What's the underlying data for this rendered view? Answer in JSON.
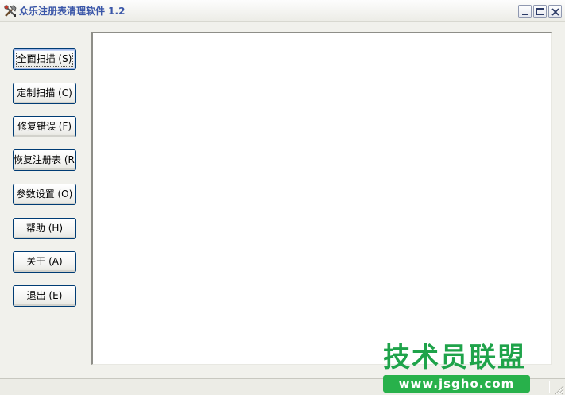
{
  "window": {
    "title": "众乐注册表清理软件 1.2",
    "icon": "tools-icon"
  },
  "window_controls": {
    "minimize_icon": "minimize-icon",
    "maximize_icon": "maximize-icon",
    "close_icon": "close-icon"
  },
  "sidebar": {
    "buttons": [
      {
        "label": "全面扫描 (S)",
        "focused": true
      },
      {
        "label": "定制扫描 (C)"
      },
      {
        "label": "修复错误 (F)"
      },
      {
        "label": "恢复注册表 (R)"
      },
      {
        "label": "参数设置 (O)"
      },
      {
        "label": "帮助 (H)"
      },
      {
        "label": "关于 (A)"
      },
      {
        "label": "退出 (E)"
      }
    ]
  },
  "main": {
    "results_list_items": []
  },
  "statusbar": {
    "text": ""
  },
  "watermark": {
    "text": "技术员联盟",
    "url": "www.jsgho.com"
  },
  "colors": {
    "title_text": "#3a56a8",
    "button_border": "#003c74",
    "watermark_green": "#1fa34a"
  }
}
